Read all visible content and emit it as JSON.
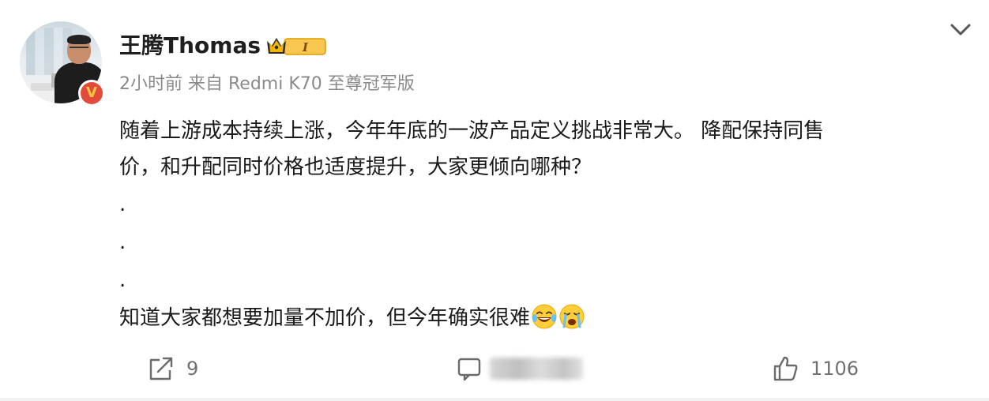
{
  "post": {
    "author": {
      "name": "王腾Thomas",
      "avatar_icon": "user-avatar-photo",
      "verified_icon": "v-verified-icon",
      "verified_mark": "V",
      "badge_icon": "crown-member-level-icon",
      "badge_level": "I"
    },
    "meta": "2小时前  来自 Redmi K70 至尊冠军版",
    "content": {
      "lines": [
        "随着上游成本持续上涨，今年年底的一波产品定义挑战非常大。 降配保持同售",
        "价，和升配同时价格也适度提升，大家更倾向哪种？"
      ],
      "dots": [
        ".",
        ".",
        "."
      ],
      "last_line": "知道大家都想要加量不加价，但今年确实很难",
      "emojis": [
        "laugh-cry-emoji",
        "crying-emoji"
      ]
    },
    "actions": {
      "share": {
        "icon": "share-icon",
        "count": "9"
      },
      "comment": {
        "icon": "comment-icon",
        "count": ""
      },
      "like": {
        "icon": "thumbs-up-icon",
        "count": "1106"
      }
    },
    "more_icon": "chevron-down-icon"
  },
  "colors": {
    "text": "#1f1f1f",
    "meta": "#8a8a8a",
    "verified_red": "#e24b3c",
    "verified_gold": "#f7c640",
    "badge_gold": "#f5b400"
  }
}
